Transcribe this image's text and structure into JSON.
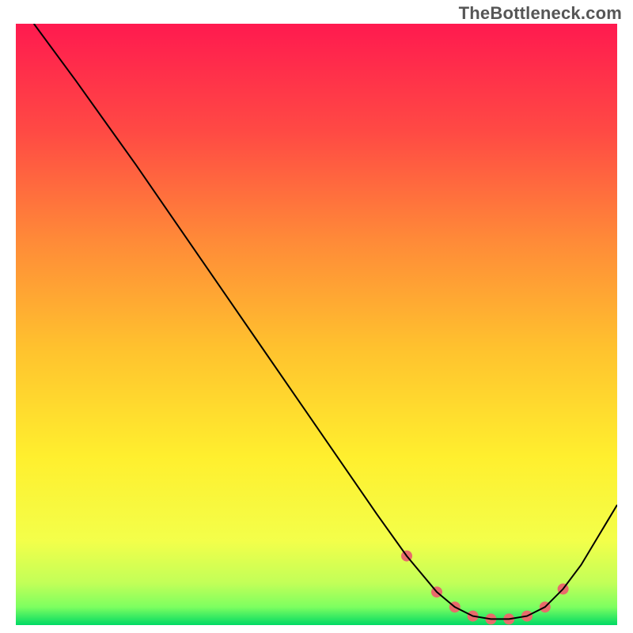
{
  "attribution": "TheBottleneck.com",
  "chart_data": {
    "type": "line",
    "title": "",
    "xlabel": "",
    "ylabel": "",
    "xlim": [
      0,
      100
    ],
    "ylim": [
      0,
      100
    ],
    "series": [
      {
        "name": "curve",
        "color": "#000000",
        "x": [
          3,
          10,
          20,
          30,
          40,
          50,
          60,
          65,
          70,
          73,
          76,
          79,
          82,
          85,
          88,
          91,
          94,
          100
        ],
        "y": [
          100,
          90.5,
          76.5,
          62,
          47.5,
          33,
          18.5,
          11.5,
          5.5,
          3,
          1.5,
          1,
          1,
          1.5,
          3,
          6,
          10,
          20
        ]
      }
    ],
    "markers": {
      "name": "highlight",
      "color": "#e86b6b",
      "radius": 7,
      "x": [
        65,
        70,
        73,
        76,
        79,
        82,
        85,
        88,
        91
      ],
      "y": [
        11.5,
        5.5,
        3,
        1.5,
        1,
        1,
        1.5,
        3,
        6
      ]
    },
    "background_gradient": {
      "top_color": "#ff1a4f",
      "mid_colors": [
        "#ff6a3c",
        "#ffb733",
        "#ffee33",
        "#f8ff4a",
        "#cfff60"
      ],
      "bottom_color": "#00d964"
    }
  }
}
